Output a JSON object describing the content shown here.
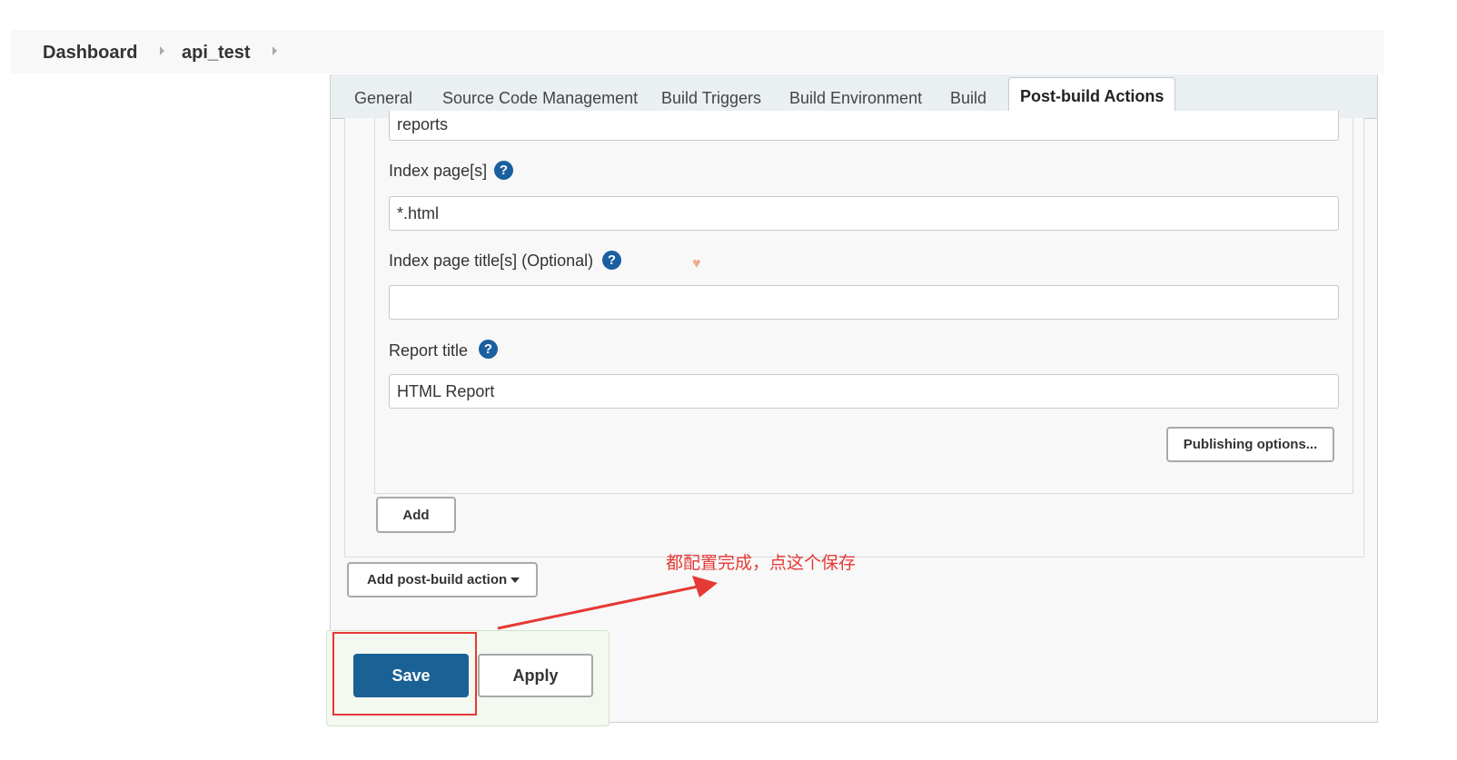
{
  "breadcrumb": {
    "items": [
      "Dashboard",
      "api_test"
    ]
  },
  "tabs": [
    "General",
    "Source Code Management",
    "Build Triggers",
    "Build Environment",
    "Build",
    "Post-build Actions"
  ],
  "active_tab": "Post-build Actions",
  "form": {
    "report_dir_value": "reports",
    "index_pages": {
      "label": "Index page[s]",
      "value": "*.html"
    },
    "index_page_titles": {
      "label": "Index page title[s] (Optional)",
      "value": ""
    },
    "report_title": {
      "label": "Report title",
      "value": "HTML Report"
    },
    "help_glyph": "?",
    "publishing_options_label": "Publishing options...",
    "add_label": "Add"
  },
  "add_post_build_action_label": "Add post-build action",
  "save_label": "Save",
  "apply_label": "Apply",
  "annotation_text": "都配置完成，点这个保存",
  "colors": {
    "primary": "#1a6196",
    "annotation": "#e53935",
    "heart": "#f0a98a"
  },
  "icons": [
    "chevron-right-icon",
    "help-icon",
    "caret-down-icon",
    "heart-icon",
    "arrow-icon"
  ]
}
